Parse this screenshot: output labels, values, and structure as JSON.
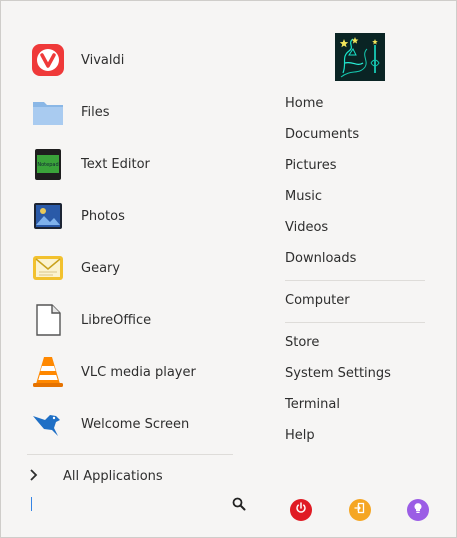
{
  "apps": [
    {
      "label": "Vivaldi",
      "icon": "vivaldi-icon"
    },
    {
      "label": "Files",
      "icon": "folder-icon"
    },
    {
      "label": "Text Editor",
      "icon": "text-editor-icon"
    },
    {
      "label": "Photos",
      "icon": "photos-icon"
    },
    {
      "label": "Geary",
      "icon": "mail-icon"
    },
    {
      "label": "LibreOffice",
      "icon": "document-icon"
    },
    {
      "label": "VLC media player",
      "icon": "vlc-cone-icon"
    },
    {
      "label": "Welcome Screen",
      "icon": "bird-icon"
    }
  ],
  "text_editor_icon_label": "Notepad",
  "all_applications_label": "All Applications",
  "places": {
    "group1": [
      "Home",
      "Documents",
      "Pictures",
      "Music",
      "Videos",
      "Downloads"
    ],
    "group2": [
      "Computer"
    ],
    "group3": [
      "Store",
      "System Settings",
      "Terminal",
      "Help"
    ]
  },
  "power_buttons": [
    {
      "name": "power-icon",
      "color": "#e01b24"
    },
    {
      "name": "logout-icon",
      "color": "#f5a623"
    },
    {
      "name": "lock-icon",
      "color": "#9b5de5"
    }
  ],
  "colors": {
    "accent": "#3584e4",
    "background": "#f6f5f4"
  }
}
